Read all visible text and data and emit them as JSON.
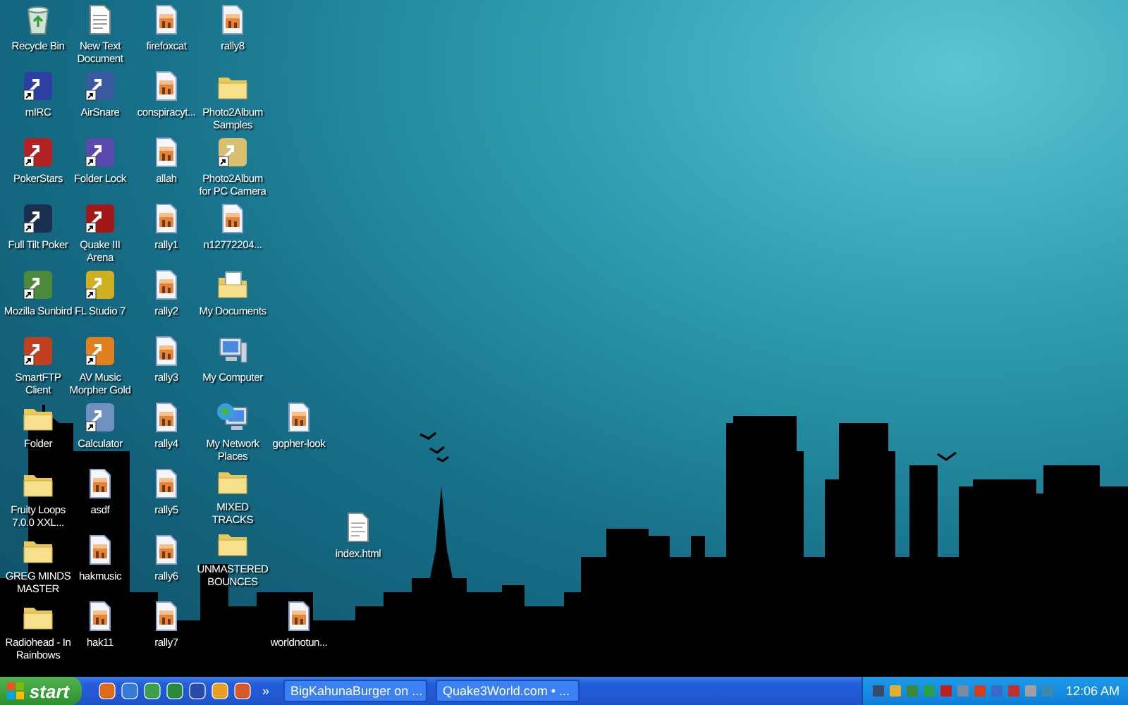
{
  "desktop": {
    "icons": [
      {
        "label": "Recycle Bin",
        "kind": "recycle_bin"
      },
      {
        "label": "mIRC",
        "kind": "app",
        "color": "#2a3fa0"
      },
      {
        "label": "PokerStars",
        "kind": "app",
        "color": "#b22222"
      },
      {
        "label": "Full Tilt Poker",
        "kind": "app",
        "color": "#1b3050"
      },
      {
        "label": "Mozilla Sunbird",
        "kind": "app",
        "color": "#4a8a3a"
      },
      {
        "label": "SmartFTP Client",
        "kind": "app",
        "color": "#c04020"
      },
      {
        "label": "Folder",
        "kind": "folder"
      },
      {
        "label": "Fruity Loops 7.0.0 XXL...",
        "kind": "folder"
      },
      {
        "label": "GREG MINDS MASTER",
        "kind": "folder"
      },
      {
        "label": "Radiohead - In Rainbows",
        "kind": "folder"
      },
      {
        "label": "New Text Document",
        "kind": "text_file"
      },
      {
        "label": "AirSnare",
        "kind": "app",
        "color": "#3a5aa0"
      },
      {
        "label": "Folder Lock",
        "kind": "app",
        "color": "#5a4ab0"
      },
      {
        "label": "Quake III Arena",
        "kind": "app",
        "color": "#a01818"
      },
      {
        "label": "FL Studio 7",
        "kind": "app",
        "color": "#d0b020"
      },
      {
        "label": "AV Music Morpher Gold",
        "kind": "app",
        "color": "#e08020"
      },
      {
        "label": "Calculator",
        "kind": "app",
        "color": "#7090c0"
      },
      {
        "label": "asdf",
        "kind": "image_file"
      },
      {
        "label": "hakmusic",
        "kind": "image_file"
      },
      {
        "label": "hak11",
        "kind": "image_file"
      },
      {
        "label": "firefoxcat",
        "kind": "image_file"
      },
      {
        "label": "conspiracyt...",
        "kind": "image_file"
      },
      {
        "label": "allah",
        "kind": "image_file"
      },
      {
        "label": "rally1",
        "kind": "image_file"
      },
      {
        "label": "rally2",
        "kind": "image_file"
      },
      {
        "label": "rally3",
        "kind": "image_file"
      },
      {
        "label": "rally4",
        "kind": "image_file"
      },
      {
        "label": "rally5",
        "kind": "image_file"
      },
      {
        "label": "rally6",
        "kind": "image_file"
      },
      {
        "label": "rally7",
        "kind": "image_file"
      },
      {
        "label": "rally8",
        "kind": "image_file"
      },
      {
        "label": "Photo2Album Samples",
        "kind": "folder"
      },
      {
        "label": "Photo2Album for PC Camera",
        "kind": "app",
        "color": "#d8c070"
      },
      {
        "label": "n12772204...",
        "kind": "image_file"
      },
      {
        "label": "My Documents",
        "kind": "my_documents"
      },
      {
        "label": "My Computer",
        "kind": "computer"
      },
      {
        "label": "My Network Places",
        "kind": "network"
      },
      {
        "label": "MIXED TRACKS",
        "kind": "folder"
      },
      {
        "label": "UNMASTERED BOUNCES",
        "kind": "folder"
      },
      {
        "label": "gopher-look",
        "kind": "image_file"
      },
      {
        "label": "worldnotun...",
        "kind": "image_file"
      },
      {
        "label": "index.html",
        "kind": "html_file"
      }
    ]
  },
  "taskbar": {
    "start_button": "start",
    "quick_launch_more": "»",
    "tasks": [
      {
        "label": "BigKahunaBurger on ...",
        "selected": false
      },
      {
        "label": "Quake3World.com • ...",
        "selected": false
      }
    ],
    "clock": "12:06 AM"
  }
}
